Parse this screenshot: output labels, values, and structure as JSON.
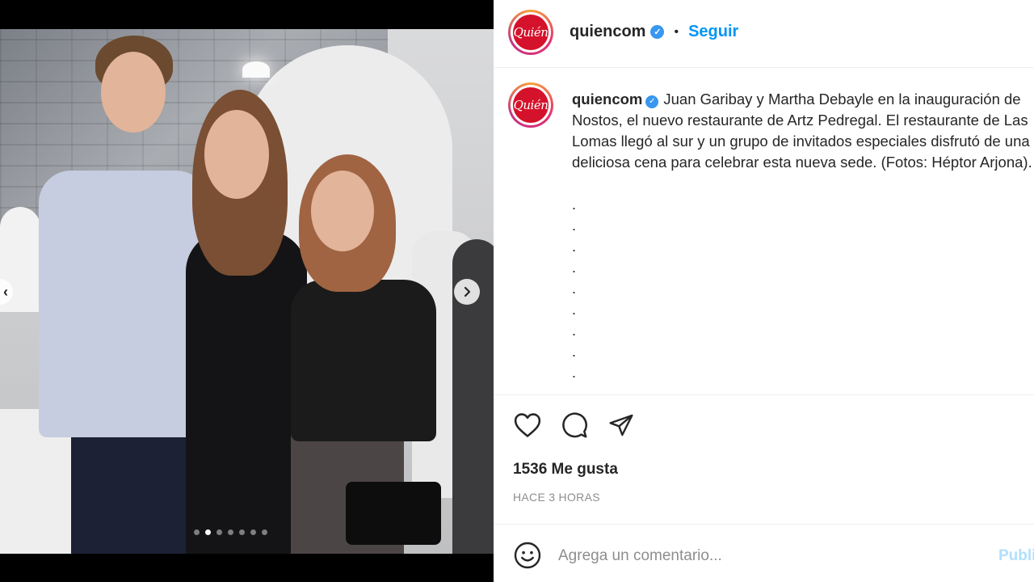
{
  "post": {
    "username": "quiencom",
    "follow_label": "Seguir",
    "avatar_text": "Quién",
    "caption": "Juan Garibay y Martha Debayle en la inauguración de Nostos, el nuevo restaurante de Artz Pedregal. El restaurante de Las Lomas llegó al sur y un grupo de invitados especiales disfrutó de una deliciosa cena para celebrar esta nueva sede. (Fotos: Héptor Arjona).",
    "caption_dots": [
      ".",
      ".",
      ".",
      ".",
      ".",
      ".",
      ".",
      ".",
      "."
    ],
    "likes": "1536 Me gusta",
    "timestamp": "HACE 3 HORAS",
    "comment_placeholder": "Agrega un comentario...",
    "publish_label": "Publi"
  },
  "carousel": {
    "total_slides": 7,
    "active_index": 1
  },
  "icons": [
    "heart-icon",
    "comment-icon",
    "share-icon",
    "emoji-icon",
    "verified-icon",
    "chevron-right-icon",
    "chevron-left-icon"
  ],
  "colors": {
    "follow": "#0095f6",
    "verified": "#3897f0",
    "brand_red": "#d5122b",
    "text": "#262626",
    "muted": "#8e8e8e"
  }
}
